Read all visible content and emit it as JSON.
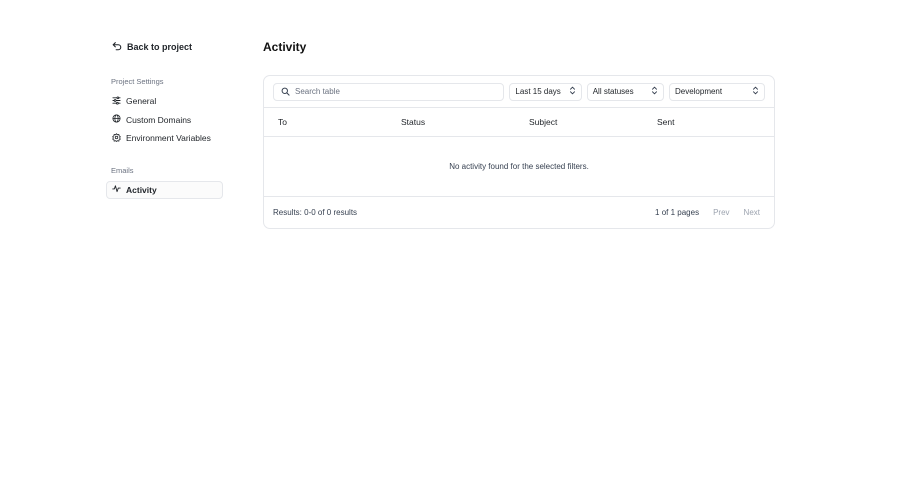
{
  "sidebar": {
    "back_label": "Back to project",
    "project_settings_title": "Project Settings",
    "settings_items": [
      {
        "label": "General",
        "icon": "sliders-icon"
      },
      {
        "label": "Custom Domains",
        "icon": "globe-icon"
      },
      {
        "label": "Environment Variables",
        "icon": "gear-icon"
      }
    ],
    "emails_title": "Emails",
    "email_items": [
      {
        "label": "Activity",
        "icon": "activity-icon",
        "active": true
      }
    ]
  },
  "main": {
    "title": "Activity",
    "toolbar": {
      "search_placeholder": "Search table",
      "search_value": "",
      "range_value": "Last 15 days",
      "status_value": "All statuses",
      "env_value": "Development"
    },
    "table": {
      "columns": [
        "To",
        "Status",
        "Subject",
        "Sent"
      ],
      "rows": [],
      "empty_message": "No activity found for the selected filters."
    },
    "footer": {
      "results_text": "Results: 0-0 of 0 results",
      "page_info": "1 of 1 pages",
      "prev_label": "Prev",
      "next_label": "Next"
    }
  },
  "colors": {
    "border": "#e5e7eb",
    "muted_text": "#6b7280",
    "disabled_text": "#9ca3af"
  }
}
